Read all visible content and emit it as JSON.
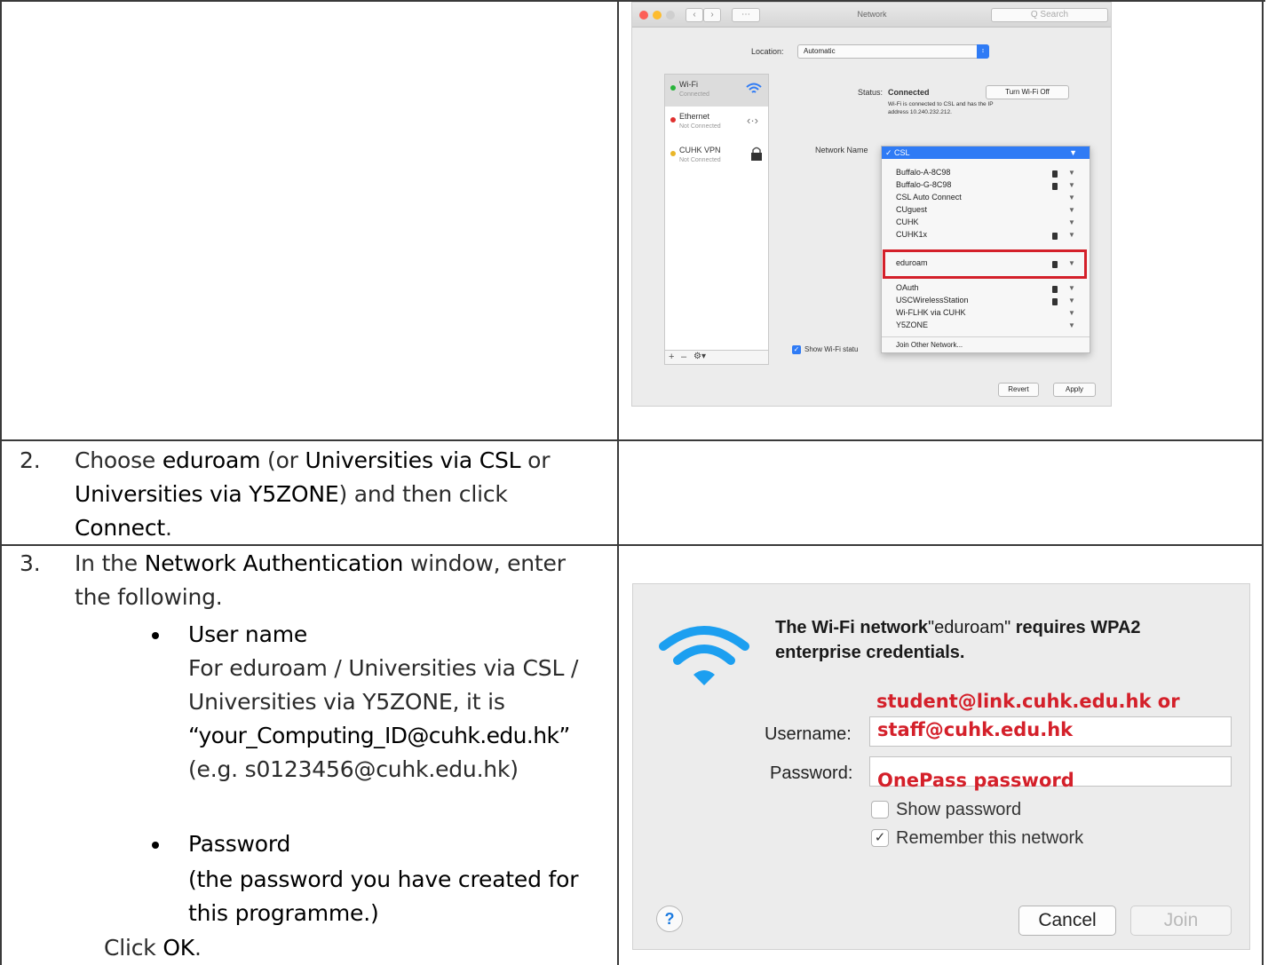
{
  "table": {
    "rows": [
      {
        "num": "2.",
        "line1": [
          "Choose ",
          "eduroam",
          " (or ",
          "Universities via CSL",
          " or"
        ],
        "line2": [
          "Universities via Y5ZONE",
          ") and then click"
        ],
        "line3": [
          "Connect",
          "."
        ]
      },
      {
        "num": "3.",
        "intro1": [
          "In the ",
          "Network Authentication",
          " window, enter"
        ],
        "intro2": "the following.",
        "bullet1_title": "User name",
        "bullet1_lines": [
          "For eduroam / Universities via CSL /",
          "Universities via Y5ZONE, it is"
        ],
        "bullet1_id": "“your_Computing_ID@cuhk.edu.hk”",
        "bullet1_example": "(e.g. s0123456@cuhk.edu.hk)",
        "bullet2_title": "Password",
        "bullet2_lines": [
          "(the password you have created for",
          "this programme.)"
        ],
        "click": [
          "Click ",
          "OK",
          "."
        ]
      }
    ]
  },
  "network_prefs": {
    "window_title": "Network",
    "search_placeholder": "Q Search",
    "location_label": "Location:",
    "location_value": "Automatic",
    "services": [
      {
        "name": "Wi-Fi",
        "status": "Connected",
        "color": "#28b43a"
      },
      {
        "name": "Ethernet",
        "status": "Not Connected",
        "color": "#e0302e"
      },
      {
        "name": "CUHK VPN",
        "status": "Not Connected",
        "color": "#e9b629"
      }
    ],
    "status_label": "Status:",
    "status_value": "Connected",
    "turn_off_button": "Turn Wi-Fi Off",
    "status_desc_1": "Wi-Fi is connected to CSL and has the IP",
    "status_desc_2": "address 10.240.232.212.",
    "network_name_label": "Network Name",
    "selected_network": "CSL",
    "networks": [
      "Buffalo-A-8C98",
      "Buffalo-G-8C98",
      "CSL Auto Connect",
      "CUguest",
      "CUHK",
      "CUHK1x",
      "eduroam",
      "OAuth",
      "USCWirelessStation",
      "Wi-FLHK via CUHK",
      "Y5ZONE"
    ],
    "join_other": "Join Other Network...",
    "show_wifi_status": "Show Wi-Fi statu",
    "revert_button": "Revert",
    "apply_button": "Apply"
  },
  "auth_dialog": {
    "message_part1": "The Wi-Fi network",
    "message_network": "\"eduroam\"",
    "message_part2": " requires WPA2",
    "message_line2": "enterprise credentials.",
    "username_label": "Username:",
    "password_label": "Password:",
    "annot_user_1": "student@link.cuhk.edu.hk or",
    "annot_user_2": "staff@cuhk.edu.hk",
    "annot_password": "OnePass password",
    "show_password": "Show password",
    "remember_network": "Remember this network",
    "remember_checked": true,
    "help": "?",
    "cancel_button": "Cancel",
    "join_button": "Join"
  }
}
